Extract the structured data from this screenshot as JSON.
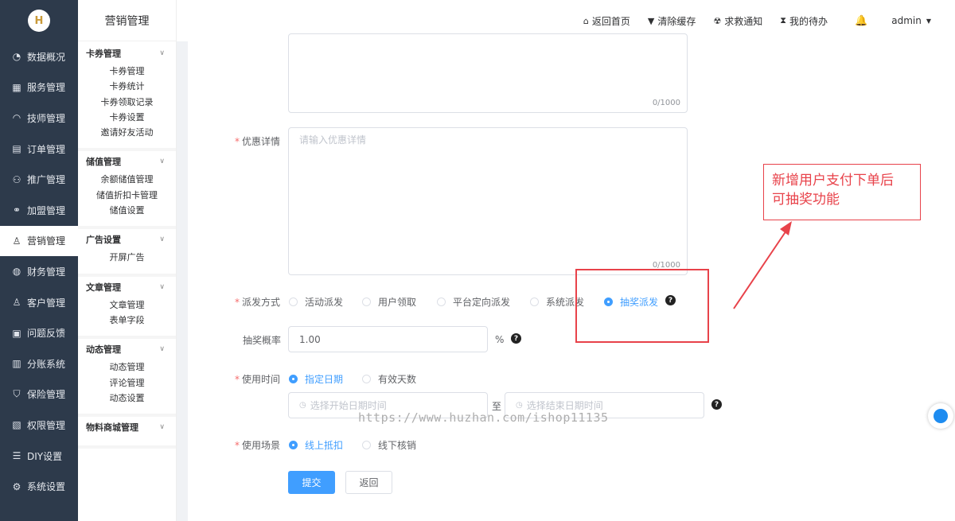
{
  "sidebar": {
    "logo_text": "H",
    "items": [
      {
        "icon": "pie-chart-icon",
        "glyph": "◔",
        "label": "数据概况"
      },
      {
        "icon": "calendar-icon",
        "glyph": "▦",
        "label": "服务管理"
      },
      {
        "icon": "headset-icon",
        "glyph": "◠",
        "label": "技师管理"
      },
      {
        "icon": "clipboard-icon",
        "glyph": "▤",
        "label": "订单管理"
      },
      {
        "icon": "network-icon",
        "glyph": "⚇",
        "label": "推广管理"
      },
      {
        "icon": "handshake-icon",
        "glyph": "⚭",
        "label": "加盟管理"
      },
      {
        "icon": "user-tag-icon",
        "glyph": "♙",
        "label": "营销管理"
      },
      {
        "icon": "money-bag-icon",
        "glyph": "◍",
        "label": "财务管理"
      },
      {
        "icon": "user-icon",
        "glyph": "♙",
        "label": "客户管理"
      },
      {
        "icon": "feedback-icon",
        "glyph": "▣",
        "label": "问题反馈"
      },
      {
        "icon": "bar-chart-icon",
        "glyph": "▥",
        "label": "分账系统"
      },
      {
        "icon": "shield-icon",
        "glyph": "⛉",
        "label": "保险管理"
      },
      {
        "icon": "permission-icon",
        "glyph": "▧",
        "label": "权限管理"
      },
      {
        "icon": "diy-icon",
        "glyph": "☰",
        "label": "DIY设置"
      },
      {
        "icon": "gear-icon",
        "glyph": "⚙",
        "label": "系统设置"
      }
    ]
  },
  "submenu": {
    "title": "营销管理",
    "groups": [
      {
        "label": "卡券管理",
        "items": [
          "卡券管理",
          "卡券统计",
          "卡券领取记录",
          "卡券设置",
          "邀请好友活动"
        ]
      },
      {
        "label": "储值管理",
        "items": [
          "余额储值管理",
          "储值折扣卡管理",
          "储值设置"
        ]
      },
      {
        "label": "广告设置",
        "items": [
          "开屏广告"
        ]
      },
      {
        "label": "文章管理",
        "items": [
          "文章管理",
          "表单字段"
        ]
      },
      {
        "label": "动态管理",
        "items": [
          "动态管理",
          "评论管理",
          "动态设置"
        ]
      },
      {
        "label": "物料商城管理",
        "items": []
      }
    ]
  },
  "header": {
    "links": [
      {
        "icon": "home-icon",
        "glyph": "⌂",
        "label": "返回首页"
      },
      {
        "icon": "brush-icon",
        "glyph": "▼",
        "label": "清除缓存"
      },
      {
        "icon": "alarm-icon",
        "glyph": "☢",
        "label": "求救通知"
      },
      {
        "icon": "hourglass-icon",
        "glyph": "⧗",
        "label": "我的待办"
      }
    ],
    "bell_glyph": "🔔",
    "user": "admin"
  },
  "form": {
    "top_textarea_count": "0/1000",
    "detail_label": "优惠详情",
    "detail_placeholder": "请输入优惠详情",
    "detail_count": "0/1000",
    "dispatch_label": "派发方式",
    "dispatch_options": [
      "活动派发",
      "用户领取",
      "平台定向派发",
      "系统派发",
      "抽奖派发"
    ],
    "dispatch_selected": "抽奖派发",
    "probability_label": "抽奖概率",
    "probability_value": "1.00",
    "probability_unit": "%",
    "time_label": "使用时间",
    "time_options": [
      "指定日期",
      "有效天数"
    ],
    "time_selected": "指定日期",
    "start_placeholder": "选择开始日期时间",
    "range_sep": "至",
    "end_placeholder": "选择结束日期时间",
    "scene_label": "使用场景",
    "scene_options": [
      "线上抵扣",
      "线下核销"
    ],
    "scene_selected": "线上抵扣",
    "submit": "提交",
    "back": "返回",
    "help_glyph": "?"
  },
  "annotation": {
    "line1": "新增用户支付下单后",
    "line2": "可抽奖功能",
    "color": "#e8424a"
  },
  "watermark": "https://www.huzhan.com/ishop11135",
  "colors": {
    "primary": "#409eff",
    "sidebar": "#2d3a4b",
    "required": "#f56c6c"
  }
}
